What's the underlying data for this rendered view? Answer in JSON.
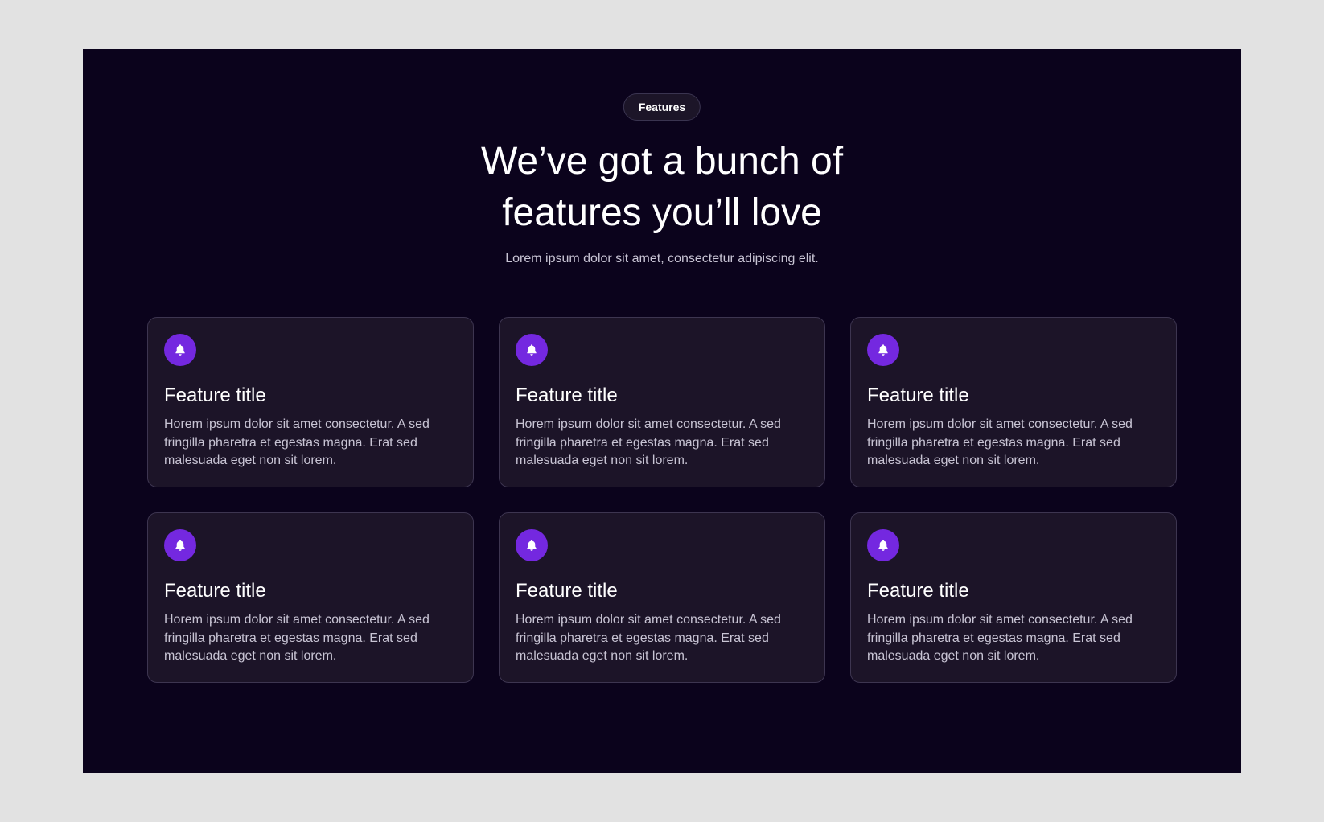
{
  "colors": {
    "page_background": "#e2e2e2",
    "section_background": "#0b031c",
    "card_background": "#1c1428",
    "card_border": "#3d3550",
    "accent": "#7428e0",
    "heading_text": "#ffffff",
    "body_text": "#c8c4d4"
  },
  "header": {
    "badge_label": "Features",
    "title": "We’ve got a bunch of features you’ll love",
    "subtitle": "Lorem ipsum dolor sit amet, consectetur adipiscing elit."
  },
  "features": [
    {
      "icon": "bell-icon",
      "title": "Feature title",
      "description": "Horem ipsum dolor sit amet consectetur. A sed fringilla pharetra et egestas magna. Erat sed malesuada eget non sit lorem."
    },
    {
      "icon": "bell-icon",
      "title": "Feature title",
      "description": "Horem ipsum dolor sit amet consectetur. A sed fringilla pharetra et egestas magna. Erat sed malesuada eget non sit lorem."
    },
    {
      "icon": "bell-icon",
      "title": "Feature title",
      "description": "Horem ipsum dolor sit amet consectetur. A sed fringilla pharetra et egestas magna. Erat sed malesuada eget non sit lorem."
    },
    {
      "icon": "bell-icon",
      "title": "Feature title",
      "description": "Horem ipsum dolor sit amet consectetur. A sed fringilla pharetra et egestas magna. Erat sed malesuada eget non sit lorem."
    },
    {
      "icon": "bell-icon",
      "title": "Feature title",
      "description": "Horem ipsum dolor sit amet consectetur. A sed fringilla pharetra et egestas magna. Erat sed malesuada eget non sit lorem."
    },
    {
      "icon": "bell-icon",
      "title": "Feature title",
      "description": "Horem ipsum dolor sit amet consectetur. A sed fringilla pharetra et egestas magna. Erat sed malesuada eget non sit lorem."
    }
  ]
}
